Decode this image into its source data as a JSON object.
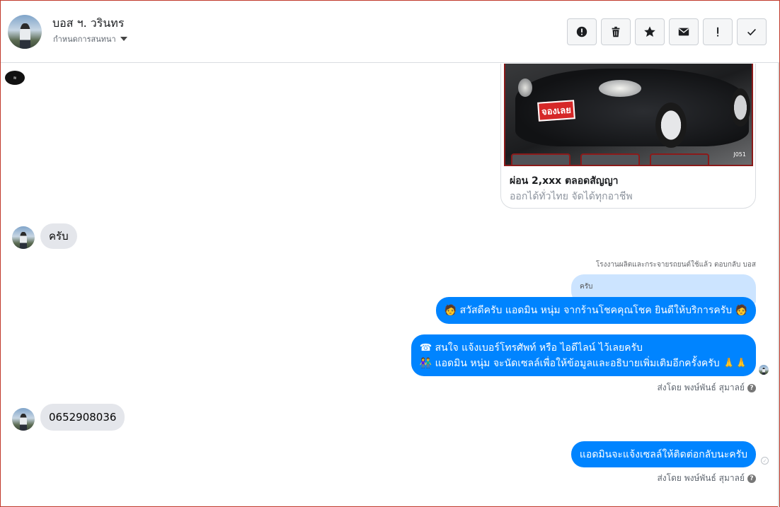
{
  "header": {
    "name": "บอส ฯ. วรินทร",
    "subtitle": "กำหนดการสนทนา",
    "toolbar": [
      {
        "icon": "alert-circle-icon"
      },
      {
        "icon": "trash-icon"
      },
      {
        "icon": "star-icon"
      },
      {
        "icon": "envelope-icon"
      },
      {
        "icon": "exclamation-icon"
      },
      {
        "icon": "checkmark-icon"
      }
    ]
  },
  "conversation": {
    "card": {
      "stamp_text": "จองเลย",
      "image_code": "J051",
      "title": "ผ่อน 2,xxx ตลอดสัญญา",
      "subtitle": "ออกได้ทั่วไทย จัดได้ทุกอาชีพ"
    },
    "msg1": "ครับ",
    "reply_info": "โรงงานผลิตและกระจายรถยนต์ใช้แล้ว ตอบกลับ บอส",
    "reply_quote": "ครับ",
    "msg2": "🧑 สวัสดีครับ แอดมิน หนุ่ม จากร้านโชคคุณโชค ยินดีให้บริการครับ 🧑",
    "msg3_line1": "☎ สนใจ แจ้งเบอร์โทรศัพท์ หรือ ไอดีไลน์  ไว้เลยครับ",
    "msg3_line2": "👫 แอดมิน หนุ่ม จะนัดเซลล์เพื่อให้ข้อมูลและอธิบายเพิ่มเติมอีกครั้งครับ 🙏🙏",
    "sent_by_1": "ส่งโดย พงษ์พันธ์ สุมาลย์",
    "msg4": "0652908036",
    "msg5": "แอดมินจะแจ้งเซลล์ให้ติดต่อกลับนะครับ",
    "sent_by_2": "ส่งโดย พงษ์พันธ์ สุมาลย์"
  },
  "colors": {
    "outgoing_bubble": "#0084ff",
    "incoming_bubble": "#e4e6eb",
    "reply_quote": "#cce4ff"
  }
}
